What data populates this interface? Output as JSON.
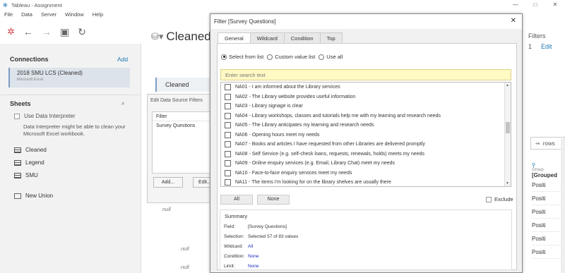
{
  "window": {
    "title": "Tableau - Assignment",
    "controls": [
      "—",
      "□",
      "✕"
    ]
  },
  "menu": [
    "File",
    "Data",
    "Server",
    "Window",
    "Help"
  ],
  "left": {
    "connections_title": "Connections",
    "add_label": "Add",
    "connection": {
      "name": "2018 SMU LCS (Cleaned)",
      "type": "Microsoft Excel"
    },
    "sheets_title": "Sheets",
    "data_interpreter": "Use Data Interpreter",
    "interpreter_hint": "Data Interpreter might be able to clean your Microsoft Excel workbook.",
    "sheets": [
      "Cleaned",
      "Legend",
      "SMU"
    ],
    "new_union": "New Union"
  },
  "main": {
    "datasource_title": "Cleaned",
    "filters_label": "Filters",
    "filters_count": "1",
    "filters_edit": "Edit",
    "table_tab": "Cleaned",
    "rows_label": "rows",
    "col_group_icon": "Group",
    "col_header": "[Grouped",
    "cells": [
      "Positi",
      "Positi",
      "Positi",
      "Positi",
      "Positi",
      "Positi"
    ],
    "nulls": [
      "null",
      "null",
      "null"
    ]
  },
  "edit_filters": {
    "title": "Edit Data Source Filters",
    "col_header": "Filter",
    "items": [
      "Survey Questions"
    ],
    "add_button": "Add...",
    "edit_button": "Edit..."
  },
  "filter_dialog": {
    "title": "Filter [Survey Questions]",
    "close": "✕",
    "tabs": [
      "General",
      "Wildcard",
      "Condition",
      "Top"
    ],
    "radios": [
      "Select from list",
      "Custom value list",
      "Use all"
    ],
    "search_placeholder": "Enter search text",
    "values": [
      "NA01 - I am informed about the Library services",
      "NA02 - The Library website provides useful information",
      "NA03 - Library signage is clear",
      "NA04 - Library workshops, classes and tutorials help me with my learning and research needs",
      "NA05 - The Library anticipates my learning and research needs",
      "NA06 - Opening hours meet my needs",
      "NA07 - Books and articles I have requested from other Libraries are delivered promptly",
      "NA08 - Self Service (e.g. self-check loans, requests, renewals, holds) meets my needs",
      "NA09 - Online enquiry services (e.g. Email, Library Chat) meet my needs",
      "NA10 - Face-to-face enquiry services meet my needs",
      "NA11 - The items I'm looking for on the library shelves are usually there"
    ],
    "all_button": "All",
    "none_button": "None",
    "exclude_label": "Exclude",
    "summary": {
      "title": "Summary",
      "field_key": "Field:",
      "field_val": "[Survey Questions]",
      "selection_key": "Selection:",
      "selection_val": "Selected 57 of 83 values",
      "wildcard_key": "Wildcard:",
      "wildcard_val": "All",
      "condition_key": "Condition:",
      "condition_val": "None",
      "limit_key": "Limit:",
      "limit_val": "None"
    }
  }
}
